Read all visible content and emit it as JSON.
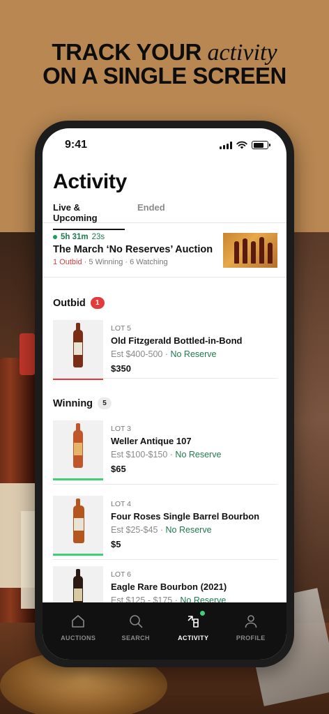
{
  "headline": {
    "line1_bold": "TRACK YOUR",
    "line1_italic": "activity",
    "line2": "ON A SINGLE SCREEN"
  },
  "status_bar": {
    "time": "9:41"
  },
  "page": {
    "title": "Activity"
  },
  "tabs": [
    {
      "label": "Live & Upcoming",
      "active": true
    },
    {
      "label": "Ended",
      "active": false
    }
  ],
  "auction": {
    "timer_hm": "5h 31m",
    "timer_s": "23s",
    "title": "The March ‘No Reserves’ Auction",
    "outbid": "1 Outbid",
    "winning": "5 Winning",
    "watching": "6 Watching",
    "separator": "·"
  },
  "sections": {
    "outbid": {
      "label": "Outbid",
      "count": "1"
    },
    "winning": {
      "label": "Winning",
      "count": "5"
    }
  },
  "items": [
    {
      "lot": "LOT 5",
      "name": "Old Fitzgerald Bottled-in-Bond",
      "est": "Est $400-500",
      "reserve": "No Reserve",
      "price": "$350",
      "status": "outbid"
    },
    {
      "lot": "LOT 3",
      "name": "Weller Antique 107",
      "est": "Est $100-$150",
      "reserve": "No Reserve",
      "price": "$65",
      "status": "winning"
    },
    {
      "lot": "LOT 4",
      "name": "Four Roses Single Barrel Bourbon",
      "est": "Est $25-$45",
      "reserve": "No Reserve",
      "price": "$5",
      "status": "winning"
    },
    {
      "lot": "LOT 6",
      "name": "Eagle Rare Bourbon (2021)",
      "est": "Est $125 - $175",
      "reserve": "No Reserve",
      "price": "",
      "status": "winning"
    }
  ],
  "nav": [
    {
      "label": "AUCTIONS",
      "icon": "home-icon",
      "active": false
    },
    {
      "label": "SEARCH",
      "icon": "search-icon",
      "active": false
    },
    {
      "label": "ACTIVITY",
      "icon": "activity-icon",
      "active": true
    },
    {
      "label": "PROFILE",
      "icon": "profile-icon",
      "active": false
    }
  ],
  "colors": {
    "background": "#b88752",
    "outbid_red": "#e23b3b",
    "winning_green": "#3ecf78",
    "reserve_green": "#1f7a4c",
    "nav_bg": "#111111"
  }
}
